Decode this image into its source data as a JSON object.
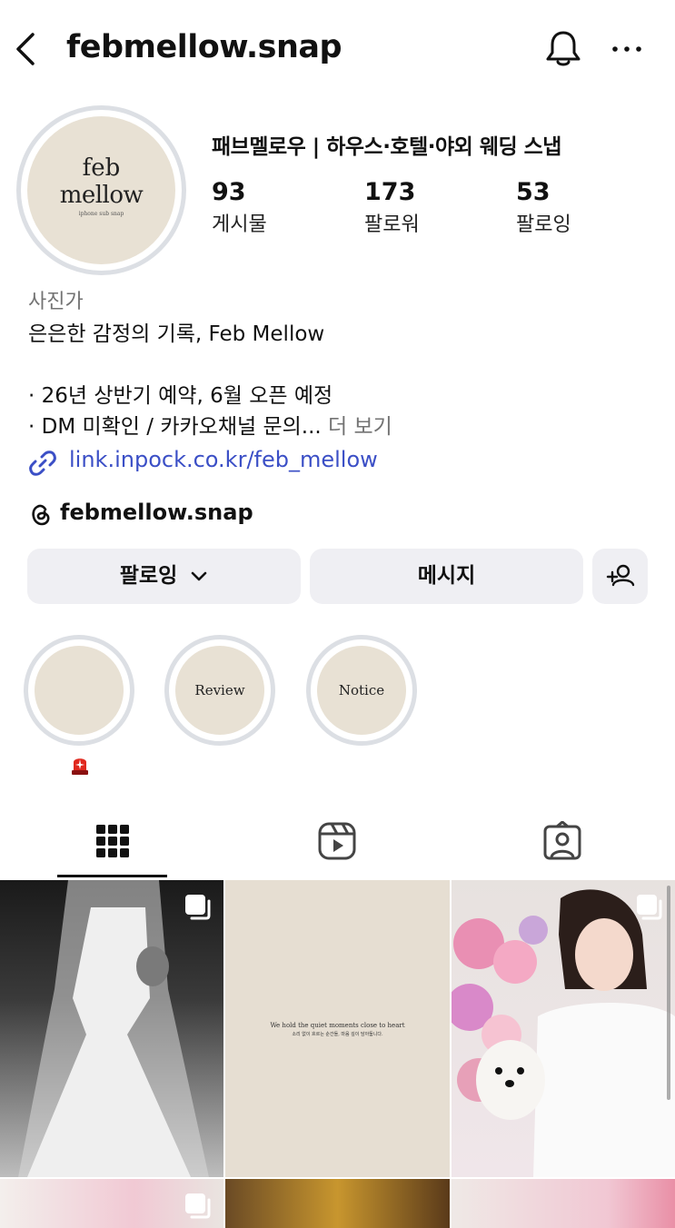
{
  "header": {
    "username": "febmellow.snap"
  },
  "profile": {
    "avatar_line1": "feb",
    "avatar_line2": "mellow",
    "avatar_line3": "iphone sub snap",
    "full_name": "패브멜로우 | 하우스·호텔·야외 웨딩 스냅",
    "stats": [
      {
        "value": "93",
        "label": "게시물"
      },
      {
        "value": "173",
        "label": "팔로워"
      },
      {
        "value": "53",
        "label": "팔로잉"
      }
    ],
    "category": "사진가",
    "bio_line1": "은은한 감정의 기록, Feb Mellow",
    "bio_line2": "· 26년 상반기 예약, 6월 오픈 예정",
    "bio_line3": "· DM 미확인 / 카카오채널 문의...",
    "bio_more": " 더 보기",
    "link": "link.inpock.co.kr/feb_mellow",
    "threads": "febmellow.snap"
  },
  "actions": {
    "following_label": "팔로잉",
    "message_label": "메시지"
  },
  "highlights": [
    {
      "label": ""
    },
    {
      "label": "Review"
    },
    {
      "label": "Notice"
    }
  ],
  "grid": {
    "quote_en": "We hold the quiet moments close to heart",
    "quote_ko": "소리 없이 흐르는 순간들, 마음 깊이 담아둡니다."
  },
  "colors": {
    "link": "#3b4fc6",
    "button_bg": "#efeff3",
    "avatar_bg": "#e8e1d4"
  },
  "icons": [
    "back-arrow-icon",
    "bell-icon",
    "more-icon",
    "link-icon",
    "threads-icon",
    "chevron-down-icon",
    "add-person-icon",
    "siren-icon",
    "grid-icon",
    "reels-icon",
    "tagged-icon",
    "multi-post-icon"
  ]
}
